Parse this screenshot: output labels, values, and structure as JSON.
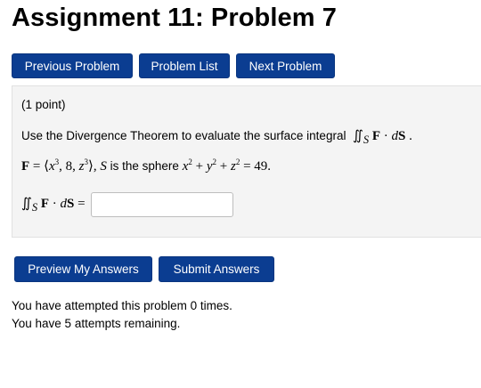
{
  "page": {
    "title": "Assignment 11: Problem 7"
  },
  "nav": {
    "previous": "Previous Problem",
    "list": "Problem List",
    "next": "Next Problem"
  },
  "problem": {
    "points": "(1 point)",
    "instruction": "Use the Divergence Theorem to evaluate the surface integral",
    "field_definition": "F = ⟨x³, 8, z³⟩,",
    "surface_description": "is the sphere",
    "sphere_equation": "x² + y² + z² = 49.",
    "answer_label": "∬S F · dS =",
    "answer_value": ""
  },
  "actions": {
    "preview": "Preview My Answers",
    "submit": "Submit Answers"
  },
  "status": {
    "attempted": "You have attempted this problem 0 times.",
    "remaining": "You have 5 attempts remaining."
  },
  "colors": {
    "button": "#0b3d91",
    "panel": "#f4f4f4"
  }
}
